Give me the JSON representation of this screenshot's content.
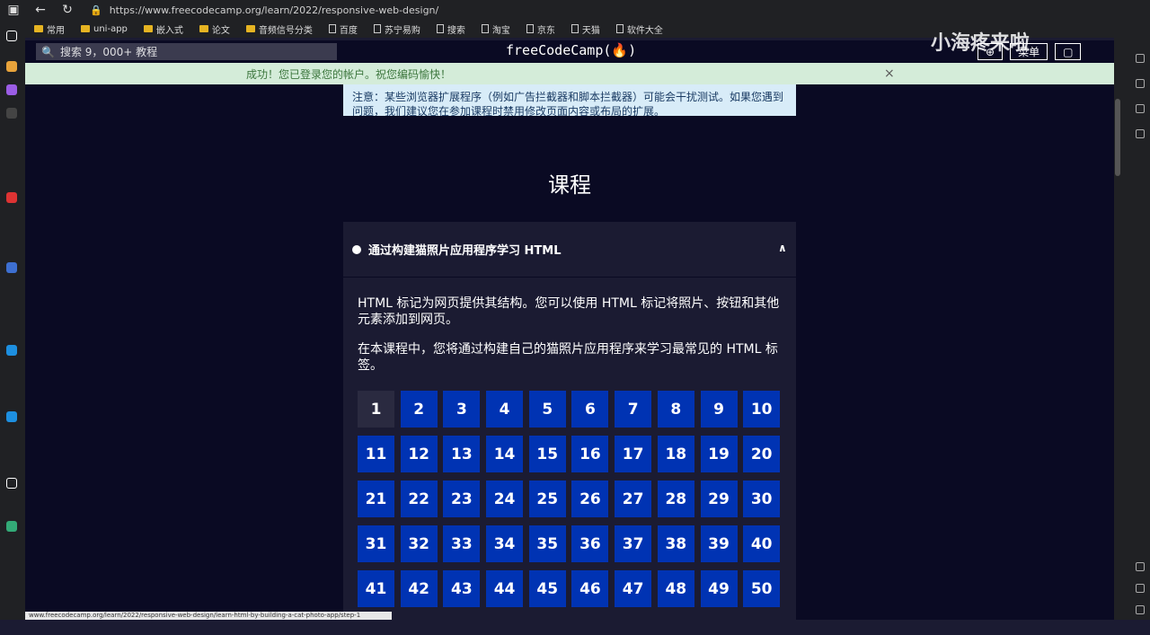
{
  "browser": {
    "url": "https://www.freecodecamp.org/learn/2022/responsive-web-design/",
    "status_url": "www.freecodecamp.org/learn/2022/responsive-web-design/learn-html-by-building-a-cat-photo-app/step-1"
  },
  "bookmarks": [
    "常用",
    "uni-app",
    "嵌入式",
    "论文",
    "音频信号分类",
    "百度",
    "苏宁易购",
    "搜索",
    "淘宝",
    "京东",
    "天猫",
    "软件大全"
  ],
  "fcc_nav": {
    "search_placeholder": "搜索 9，000+ 教程",
    "logo": "freeCodeCamp(🔥)",
    "btn_menu": "菜单"
  },
  "watermark": "小海疼来啦",
  "alert": {
    "message": "成功！您已登录您的帐户。祝您编码愉快！",
    "close": "×"
  },
  "note": "注意：某些浏览器扩展程序（例如广告拦截器和脚本拦截器）可能会干扰测试。如果您遇到问题，我们建议您在参加课程时禁用修改页面内容或布局的扩展。",
  "main": {
    "heading": "课程",
    "block_title": "通过构建猫照片应用程序学习 HTML",
    "desc1": "HTML 标记为网页提供其结构。您可以使用 HTML 标记将照片、按钮和其他元素添加到网页。",
    "desc2": "在本课程中，您将通过构建自己的猫照片应用程序来学习最常见的 HTML 标签。"
  },
  "steps": [
    "1",
    "2",
    "3",
    "4",
    "5",
    "6",
    "7",
    "8",
    "9",
    "10",
    "11",
    "12",
    "13",
    "14",
    "15",
    "16",
    "17",
    "18",
    "19",
    "20",
    "21",
    "22",
    "23",
    "24",
    "25",
    "26",
    "27",
    "28",
    "29",
    "30",
    "31",
    "32",
    "33",
    "34",
    "35",
    "36",
    "37",
    "38",
    "39",
    "40",
    "41",
    "42",
    "43",
    "44",
    "45",
    "46",
    "47",
    "48",
    "49",
    "50"
  ],
  "colors": {
    "step_bg": "#0033b3",
    "step_current_bg": "#2a2a40",
    "page_bg": "#0a0a23",
    "alert_bg": "#d4ecd9"
  }
}
